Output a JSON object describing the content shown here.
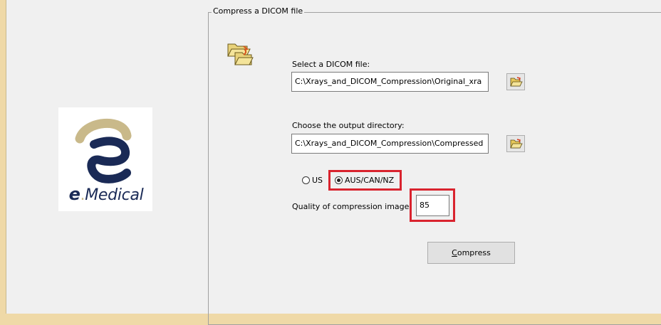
{
  "logo": {
    "e_letter": "e",
    "dot": ".",
    "text": "Medical"
  },
  "group": {
    "title": "Compress a DICOM file"
  },
  "dicom_file": {
    "label": "Select a DICOM file:",
    "value": "C:\\Xrays_and_DICOM_Compression\\Original_xra"
  },
  "output_dir": {
    "label": "Choose the output directory:",
    "value": "C:\\Xrays_and_DICOM_Compression\\Compressed"
  },
  "region": {
    "options": [
      "US",
      "AUS/CAN/NZ"
    ],
    "selected": "AUS/CAN/NZ"
  },
  "quality": {
    "label": "Quality of compression image:",
    "value": "85"
  },
  "compress_button": {
    "label_first": "C",
    "label_rest": "ompress"
  },
  "colors": {
    "highlight": "#d9232e",
    "logo_blue": "#1a2a56",
    "logo_gold": "#c9b98a",
    "background": "#efd9a7"
  },
  "icons": [
    "folder-open-icon",
    "folder-browse-icon"
  ]
}
